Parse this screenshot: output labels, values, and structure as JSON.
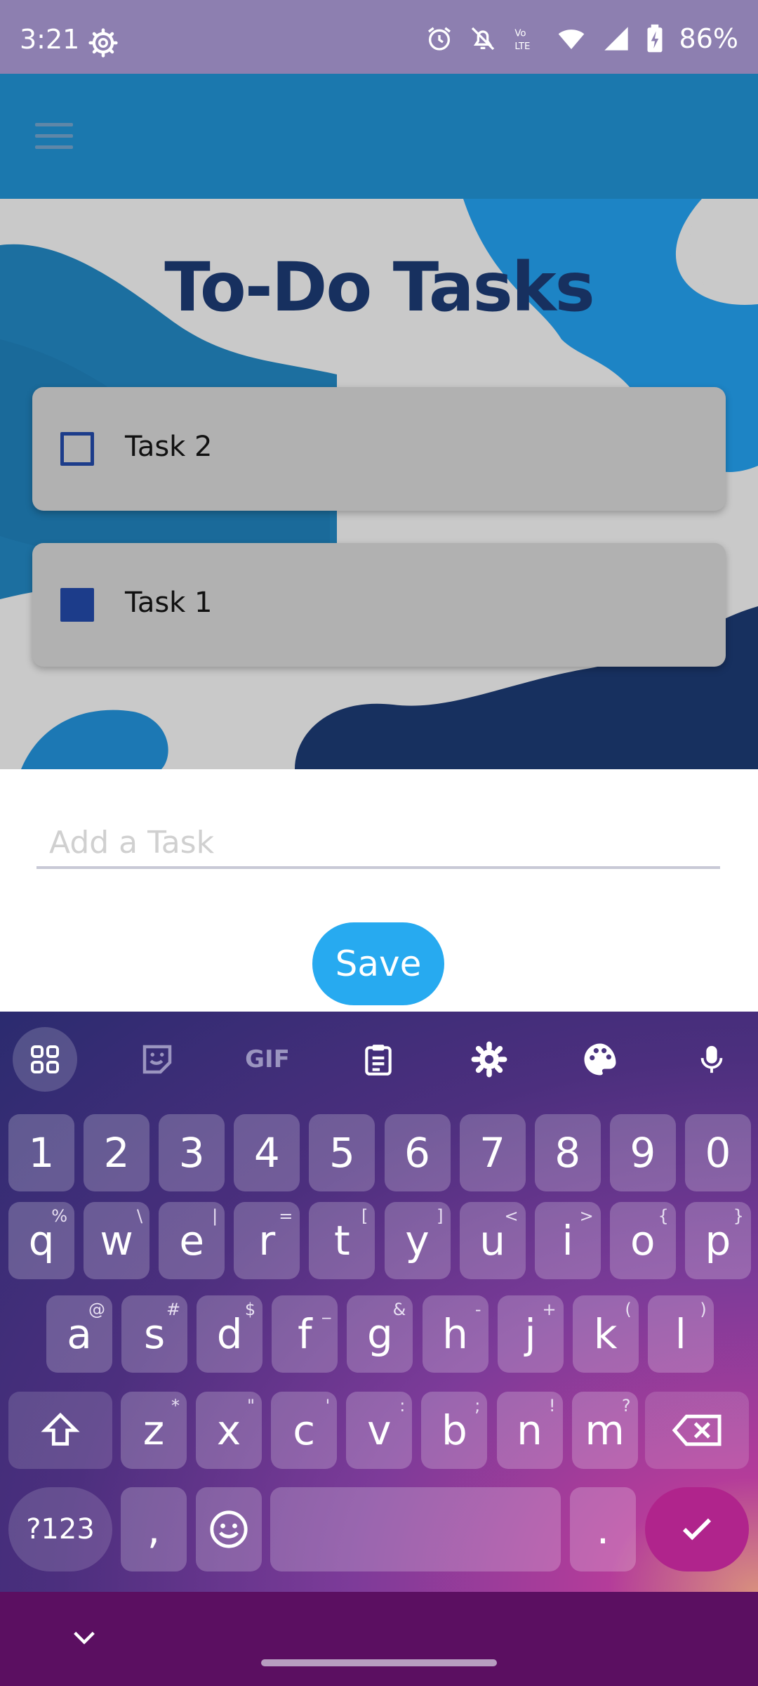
{
  "status_bar": {
    "time": "3:21",
    "battery": "86%",
    "icons": [
      "settings-icon",
      "alarm-icon",
      "notifications-off-icon",
      "volte-icon",
      "wifi-icon",
      "signal-icon",
      "battery-charging-icon"
    ]
  },
  "app_bar": {
    "menu_icon": "hamburger-menu-icon",
    "color": "#1b78ae"
  },
  "hero": {
    "title": "To-Do Tasks",
    "title_color": "#17305f"
  },
  "tasks": [
    {
      "label": "Task 2",
      "checked": false
    },
    {
      "label": "Task 1",
      "checked": true
    }
  ],
  "input": {
    "placeholder": "Add a Task",
    "value": ""
  },
  "save_button": {
    "label": "Save",
    "color": "#27aaf0"
  },
  "keyboard": {
    "toolbar": [
      "apps-grid-icon",
      "sticker-icon",
      "GIF",
      "clipboard-icon",
      "settings-icon",
      "palette-icon",
      "microphone-icon"
    ],
    "gif_label": "GIF",
    "row_numbers": [
      "1",
      "2",
      "3",
      "4",
      "5",
      "6",
      "7",
      "8",
      "9",
      "0"
    ],
    "row_q": [
      {
        "k": "q",
        "h": "%"
      },
      {
        "k": "w",
        "h": "\\"
      },
      {
        "k": "e",
        "h": "|"
      },
      {
        "k": "r",
        "h": "="
      },
      {
        "k": "t",
        "h": "["
      },
      {
        "k": "y",
        "h": "]"
      },
      {
        "k": "u",
        "h": "<"
      },
      {
        "k": "i",
        "h": ">"
      },
      {
        "k": "o",
        "h": "{"
      },
      {
        "k": "p",
        "h": "}"
      }
    ],
    "row_a": [
      {
        "k": "a",
        "h": "@"
      },
      {
        "k": "s",
        "h": "#"
      },
      {
        "k": "d",
        "h": "$"
      },
      {
        "k": "f",
        "h": "_"
      },
      {
        "k": "g",
        "h": "&"
      },
      {
        "k": "h",
        "h": "-"
      },
      {
        "k": "j",
        "h": "+"
      },
      {
        "k": "k",
        "h": "("
      },
      {
        "k": "l",
        "h": ")"
      }
    ],
    "row_z": [
      {
        "k": "z",
        "h": "*"
      },
      {
        "k": "x",
        "h": "\""
      },
      {
        "k": "c",
        "h": "'"
      },
      {
        "k": "v",
        "h": ":"
      },
      {
        "k": "b",
        "h": ";"
      },
      {
        "k": "n",
        "h": "!"
      },
      {
        "k": "m",
        "h": "?"
      }
    ],
    "symbols_label": "?123",
    "comma": ",",
    "period": "."
  },
  "nav_bar": {
    "color": "#5b0f61"
  }
}
